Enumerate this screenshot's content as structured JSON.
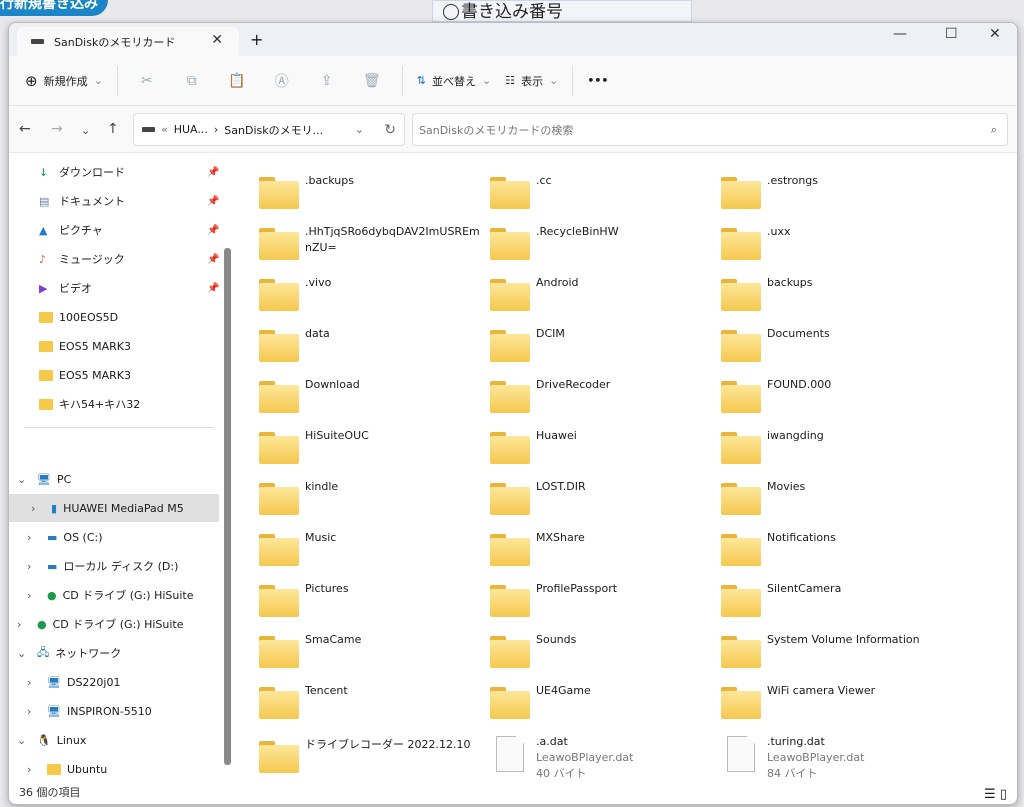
{
  "background": {
    "button": "行新規書き込み",
    "radio_label": "書き込み番号"
  },
  "tab": {
    "title": "SanDiskのメモリカード",
    "close": "✕",
    "new": "+"
  },
  "window_controls": {
    "min": "—",
    "max": "☐",
    "close": "✕"
  },
  "toolbar": {
    "new": "新規作成",
    "sort": "並べ替え",
    "view": "表示",
    "more": "•••"
  },
  "address": {
    "crumb1": "HUA...",
    "crumb2": "SanDiskのメモリ...",
    "search_placeholder": "SanDiskのメモリカードの検索"
  },
  "sidebar": {
    "quick": [
      {
        "label": "ダウンロード",
        "icon": "download-icon"
      },
      {
        "label": "ドキュメント",
        "icon": "document-icon"
      },
      {
        "label": "ピクチャ",
        "icon": "pictures-icon"
      },
      {
        "label": "ミュージック",
        "icon": "music-icon"
      },
      {
        "label": "ビデオ",
        "icon": "video-icon"
      }
    ],
    "folders": [
      "100EOS5D",
      "EOS5 MARK3",
      "EOS5 MARK3",
      "キハ54+キハ32"
    ],
    "tree": [
      {
        "label": "PC",
        "level": 0,
        "expanded": true
      },
      {
        "label": "HUAWEI MediaPad M5",
        "level": 1,
        "selected": true
      },
      {
        "label": "OS (C:)",
        "level": 1
      },
      {
        "label": "ローカル ディスク (D:)",
        "level": 1
      },
      {
        "label": "CD ドライブ (G:) HiSuite",
        "level": 1
      },
      {
        "label": "CD ドライブ (G:) HiSuite",
        "level": 0
      },
      {
        "label": "ネットワーク",
        "level": 0,
        "expanded": true
      },
      {
        "label": "DS220j01",
        "level": 1
      },
      {
        "label": "INSPIRON-5510",
        "level": 1
      },
      {
        "label": "Linux",
        "level": 0,
        "expanded": true
      },
      {
        "label": "Ubuntu",
        "level": 1
      }
    ]
  },
  "items": [
    ".backups",
    ".cc",
    ".estrongs",
    ".HhTjqSRo6dybqDAV2ImUSREmnZU=",
    ".RecycleBinHW",
    ".uxx",
    ".vivo",
    "Android",
    "backups",
    "data",
    "DCIM",
    "Documents",
    "Download",
    "DriveRecoder",
    "FOUND.000",
    "HiSuiteOUC",
    "Huawei",
    "iwangding",
    "kindle",
    "LOST.DIR",
    "Movies",
    "Music",
    "MXShare",
    "Notifications",
    "Pictures",
    "ProfilePassport",
    "SilentCamera",
    "SmaCame",
    "Sounds",
    "System Volume Information",
    "Tencent",
    "UE4Game",
    "WiFi camera Viewer",
    "ドライブレコーダー 2022.12.10"
  ],
  "files": [
    {
      "name": ".a.dat",
      "type": "LeawoBPlayer.dat",
      "size": "40 バイト"
    },
    {
      "name": ".turing.dat",
      "type": "LeawoBPlayer.dat",
      "size": "84 バイト"
    }
  ],
  "status": {
    "count": "36 個の項目"
  }
}
